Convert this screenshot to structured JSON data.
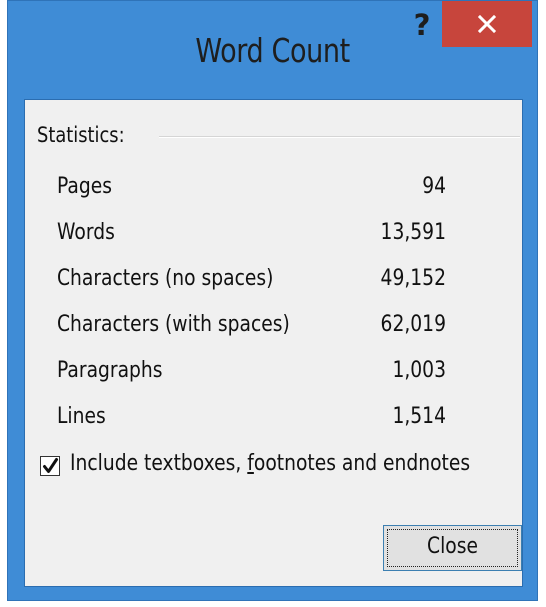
{
  "window": {
    "title": "Word Count",
    "help_label": "?"
  },
  "statistics": {
    "group_label": "Statistics:",
    "rows": [
      {
        "label": "Pages",
        "value": "94"
      },
      {
        "label": "Words",
        "value": "13,591"
      },
      {
        "label": "Characters (no spaces)",
        "value": "49,152"
      },
      {
        "label": "Characters (with spaces)",
        "value": "62,019"
      },
      {
        "label": "Paragraphs",
        "value": "1,003"
      },
      {
        "label": "Lines",
        "value": "1,514"
      }
    ]
  },
  "option": {
    "checked": true,
    "label_before": "Include textboxes, ",
    "label_underlined": "f",
    "label_after": "ootnotes and endnotes"
  },
  "buttons": {
    "close_label": "Close"
  },
  "colors": {
    "frame": "#3f8cd6",
    "close_x_background": "#c7453c",
    "client_background": "#f0f0f0"
  },
  "icons": {
    "close": "close-x-icon",
    "check": "checkmark-icon"
  }
}
